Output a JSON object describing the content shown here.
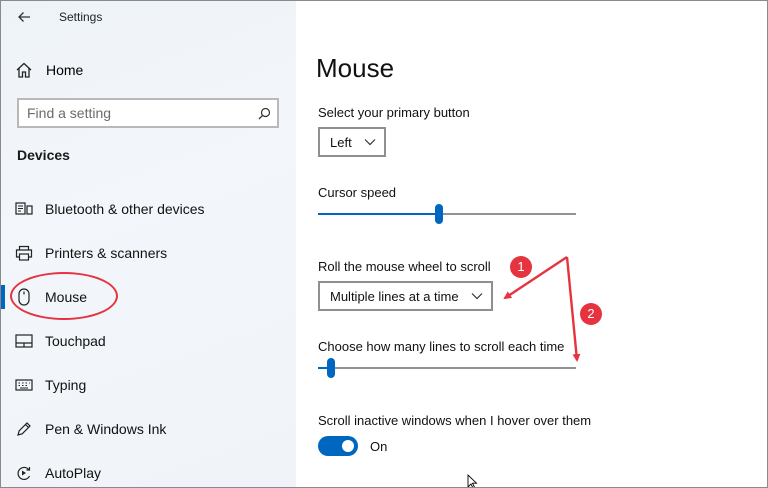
{
  "window": {
    "title": "Settings"
  },
  "sidebar": {
    "home_label": "Home",
    "search_placeholder": "Find a setting",
    "section_title": "Devices",
    "items": [
      {
        "label": "Bluetooth & other devices",
        "icon": "bluetooth-devices-icon"
      },
      {
        "label": "Printers & scanners",
        "icon": "printer-icon"
      },
      {
        "label": "Mouse",
        "icon": "mouse-icon",
        "selected": true
      },
      {
        "label": "Touchpad",
        "icon": "touchpad-icon"
      },
      {
        "label": "Typing",
        "icon": "keyboard-icon"
      },
      {
        "label": "Pen & Windows Ink",
        "icon": "pen-icon"
      },
      {
        "label": "AutoPlay",
        "icon": "autoplay-icon"
      }
    ]
  },
  "main": {
    "title": "Mouse",
    "primary_button": {
      "label": "Select your primary button",
      "value": "Left"
    },
    "cursor_speed": {
      "label": "Cursor speed",
      "value_fraction": 0.47
    },
    "wheel_scroll": {
      "label": "Roll the mouse wheel to scroll",
      "value": "Multiple lines at a time"
    },
    "lines_to_scroll": {
      "label": "Choose how many lines to scroll each time",
      "value_fraction": 0.05
    },
    "inactive_scroll": {
      "label": "Scroll inactive windows when I hover over them",
      "state_label": "On",
      "on": true
    }
  },
  "annotations": {
    "callout_1": "1",
    "callout_2": "2"
  },
  "colors": {
    "accent": "#0067c0",
    "annotation_red": "#e5333f",
    "sidebar_bg": "#f0f4f8"
  }
}
